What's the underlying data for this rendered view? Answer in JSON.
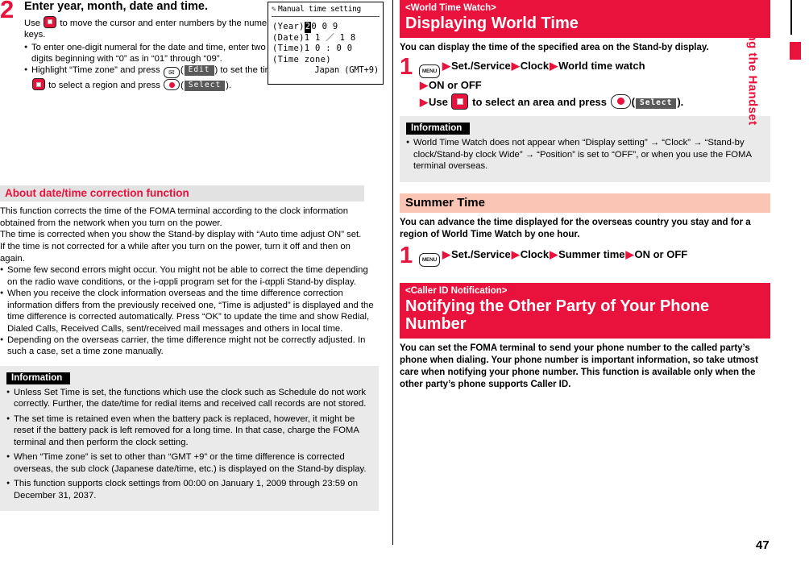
{
  "page": {
    "number": "47",
    "side_tab_label": "Before Using the Handset"
  },
  "left_column": {
    "step": {
      "number": "2",
      "title": "Enter year, month, date and time.",
      "intro_before_key": "Use",
      "intro_after_key": "to move the cursor and enter numbers by the numeric keys.",
      "bullets": [
        {
          "text": "To enter one-digit numeral for the date and time, enter two digits beginning with “0” as in “01” through “09”."
        },
        {
          "seg1": "Highlight “Time zone” and press",
          "mail_key_glyph": "✉",
          "softkey1": "Edit",
          "seg2": ") to set the time zone. Use",
          "seg3": "to select a region and press",
          "softkey2": "Select",
          "seg4": ")."
        }
      ]
    },
    "phone_screen": {
      "title": "Manual time setting",
      "title_icon": "pencil-icon",
      "rows": [
        {
          "label": "(Year)",
          "cursor": "2",
          "value": "0 0 9"
        },
        {
          "label": "(Date)",
          "cursor": "",
          "value": "1 1 ／ 1 8"
        },
        {
          "label": "(Time)",
          "cursor": "",
          "value": "1 0 : 0 0"
        },
        {
          "label": "(Time zone)",
          "cursor": "",
          "value": ""
        }
      ],
      "timezone_value": "Japan (GMT+9)"
    },
    "about_section": {
      "heading": "About date/time correction function",
      "paragraphs": [
        "This function corrects the time of the FOMA terminal according to the clock information obtained from the network when you turn on the power.",
        "The time is corrected when you show the Stand-by display with “Auto time adjust ON” set.",
        "If the time is not corrected for a while after you turn on the power, turn it off and then on again."
      ],
      "bullets": [
        "Some few second errors might occur. You might not be able to correct the time depending on the radio wave conditions, or the i-αppli program set for the i-αppli Stand-by display.",
        "When you receive the clock information overseas and the time difference correction information differs from the previously received one, “Time is adjusted” is displayed and the time difference is corrected automatically. Press “OK” to update the time and show Redial, Dialed Calls, Received Calls, sent/received mail messages and others in local time.",
        "Depending on the overseas carrier, the time difference might not be correctly adjusted. In such a case, set a time zone manually."
      ]
    },
    "information_box": {
      "label": "Information",
      "bullets": [
        "Unless Set Time is set, the functions which use the clock such as Schedule do not work correctly. Further, the date/time for redial items and received call records are not stored.",
        "The set time is retained even when the battery pack is replaced, however, it might be reset if the battery pack is left removed for a long time. In that case, charge the FOMA terminal and then perform the clock setting.",
        "When “Time zone” is set to other than “GMT +9” or the time difference is corrected overseas, the sub clock (Japanese date/time, etc.) is displayed on the Stand-by display.",
        "This function supports clock settings from 00:00 on January 1, 2009 through 23:59 on December 31, 2037."
      ]
    }
  },
  "right_column": {
    "world_time": {
      "header_sub": "<World Time Watch>",
      "header_main": "Displaying World Time",
      "lead": "You can display the time of the specified area on the Stand-by display.",
      "step_number": "1",
      "menu_key_label": "MENU",
      "line1_items": [
        "Set./Service",
        "Clock",
        "World time watch"
      ],
      "line2_items": [
        "ON or OFF"
      ],
      "line3_prefix": "Use",
      "line3_middle": "to select an area and press",
      "line3_softkey": "Select",
      "line3_suffix": ")."
    },
    "world_time_information": {
      "label": "Information",
      "bullets": [
        "World Time Watch does not appear when “Display setting” → “Clock” → “Stand-by clock/Stand-by clock Wide” → “Position” is set to “OFF”, or when you use the FOMA terminal overseas."
      ]
    },
    "summer_time": {
      "heading": "Summer Time",
      "lead": "You can advance the time displayed for the overseas country you stay and for a region of World Time Watch by one hour.",
      "step_number": "1",
      "menu_key_label": "MENU",
      "line1_items": [
        "Set./Service",
        "Clock",
        "Summer time",
        "ON or OFF"
      ]
    },
    "caller_id": {
      "header_sub": "<Caller ID Notification>",
      "header_main": "Notifying the Other Party of Your Phone Number",
      "lead": "You can set the FOMA terminal to send your phone number to the called party’s phone when dialing. Your phone number is important information, so take utmost care when notifying your phone number. This function is available only when the other party’s phone supports Caller ID."
    }
  },
  "colors": {
    "brand_red": "#e8123c",
    "pink_header": "#fac5b4",
    "grey_header": "#e2e2e2",
    "info_bg": "#eaeaea"
  }
}
